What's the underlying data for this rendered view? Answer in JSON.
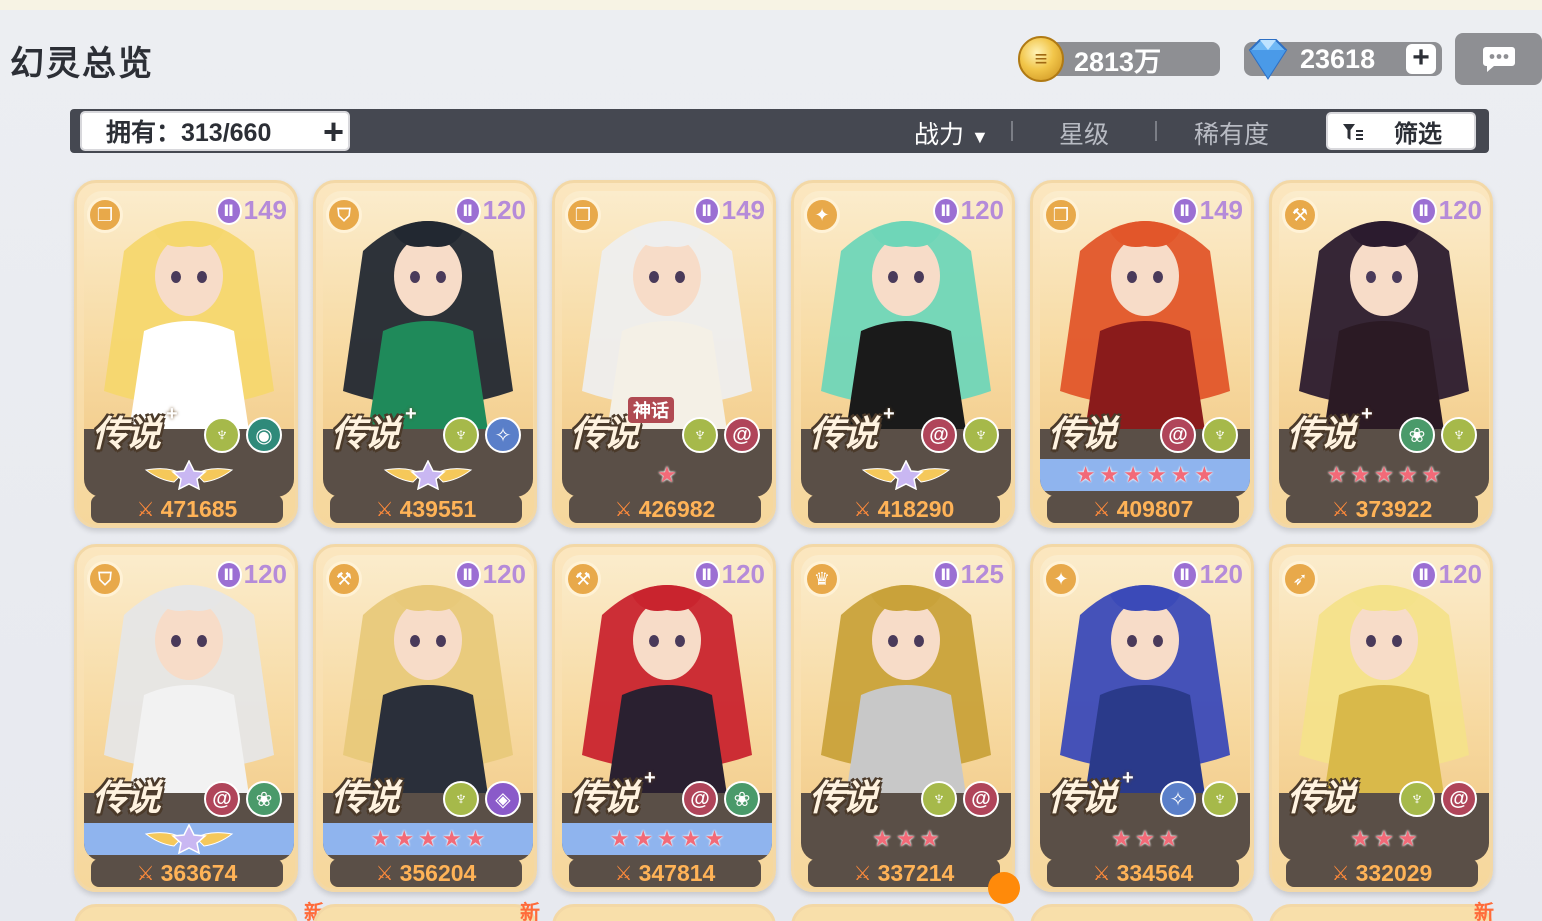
{
  "header": {
    "title": "幻灵总览",
    "gold_amount": "2813万",
    "gems_amount": "23618",
    "gold_icon": "coin-icon",
    "gem_icon": "diamond-icon",
    "chat_icon": "chat-bubble-icon"
  },
  "filter_bar": {
    "owned_label": "拥有：313/660",
    "sort_power": "战力",
    "sort_power_arrow": "▼",
    "sort_star": "星级",
    "sort_rarity": "稀有度",
    "filter_label": "筛选"
  },
  "cards": [
    {
      "level": "149",
      "rarity": "传说",
      "plus": "+",
      "power": "471685",
      "class": "book"
    },
    {
      "level": "120",
      "rarity": "传说",
      "plus": "+",
      "power": "439551",
      "class": "shield"
    },
    {
      "level": "149",
      "rarity": "传说",
      "plus": "",
      "tag": "神话",
      "power": "426982",
      "class": "book"
    },
    {
      "level": "120",
      "rarity": "传说",
      "plus": "+",
      "power": "418290",
      "class": "wing"
    },
    {
      "level": "149",
      "rarity": "传说",
      "plus": "",
      "power": "409807",
      "class": "book"
    },
    {
      "level": "120",
      "rarity": "传说",
      "plus": "+",
      "power": "373922",
      "class": "hammer"
    },
    {
      "level": "120",
      "rarity": "传说",
      "plus": "",
      "power": "363674",
      "class": "shield"
    },
    {
      "level": "120",
      "rarity": "传说",
      "plus": "",
      "power": "356204",
      "class": "hammer"
    },
    {
      "level": "120",
      "rarity": "传说",
      "plus": "+",
      "power": "347814",
      "class": "hammer"
    },
    {
      "level": "125",
      "rarity": "传说",
      "plus": "",
      "power": "337214",
      "class": "helmet"
    },
    {
      "level": "120",
      "rarity": "传说",
      "plus": "+",
      "power": "334564",
      "class": "wing"
    },
    {
      "level": "120",
      "rarity": "传说",
      "plus": "",
      "power": "332029",
      "class": "bow"
    }
  ],
  "stars": {
    "star_glyph": "★"
  },
  "peek_tags": [
    "新",
    "新",
    "新"
  ],
  "colors": {
    "card_bg": "#f6d79c",
    "band": "#5a4f47",
    "power_text": "#ffb357",
    "star_color": "#f26a78",
    "blue_band": "#8fb4ee",
    "level_purple": "#9b6fd3"
  }
}
